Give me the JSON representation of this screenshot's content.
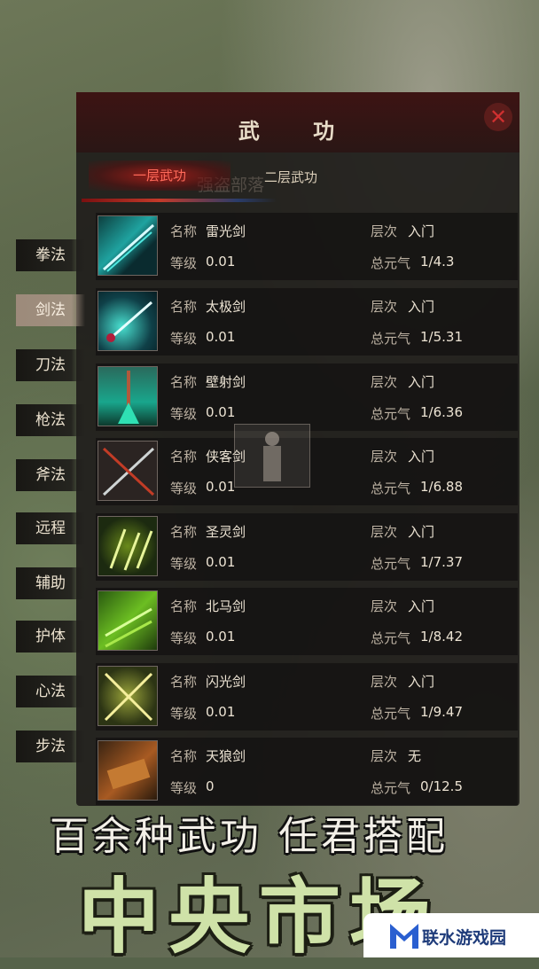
{
  "panel": {
    "title": "武 功",
    "close_label": "✕",
    "tabs": [
      "一层武功",
      "二层武功"
    ],
    "ghost_text": "强盗部落"
  },
  "sidebar": {
    "items": [
      "拳法",
      "剑法",
      "刀法",
      "枪法",
      "斧法",
      "远程",
      "辅助",
      "护体",
      "心法",
      "步法"
    ],
    "active": "剑法"
  },
  "labels": {
    "name": "名称",
    "level": "等级",
    "tier": "层次",
    "qi": "总元气"
  },
  "skills": [
    {
      "name": "雷光剑",
      "level": "0.01",
      "tier": "入门",
      "qi": "1/4.3",
      "icon": "lightning-sword-icon"
    },
    {
      "name": "太极剑",
      "level": "0.01",
      "tier": "入门",
      "qi": "1/5.31",
      "icon": "taiji-sword-icon"
    },
    {
      "name": "壁射剑",
      "level": "0.01",
      "tier": "入门",
      "qi": "1/6.36",
      "icon": "wall-shot-sword-icon"
    },
    {
      "name": "侠客剑",
      "level": "0.01",
      "tier": "入门",
      "qi": "1/6.88",
      "icon": "crossed-swords-icon"
    },
    {
      "name": "圣灵剑",
      "level": "0.01",
      "tier": "入门",
      "qi": "1/7.37",
      "icon": "spirit-daggers-icon"
    },
    {
      "name": "北马剑",
      "level": "0.01",
      "tier": "入门",
      "qi": "1/8.42",
      "icon": "green-blades-icon"
    },
    {
      "name": "闪光剑",
      "level": "0.01",
      "tier": "入门",
      "qi": "1/9.47",
      "icon": "flash-swords-icon"
    },
    {
      "name": "天狼剑",
      "level": "0",
      "tier": "无",
      "qi": "0/12.5",
      "icon": "wolf-sword-icon"
    }
  ],
  "promo": {
    "slogan": "百余种武功 任君搭配",
    "market": "中央市场",
    "logo_text": "联水游戏园"
  },
  "colors": {
    "accent_red": "#a01e19",
    "active_tab_text": "#ff6a5a",
    "market_green": "#cfe2a8"
  }
}
